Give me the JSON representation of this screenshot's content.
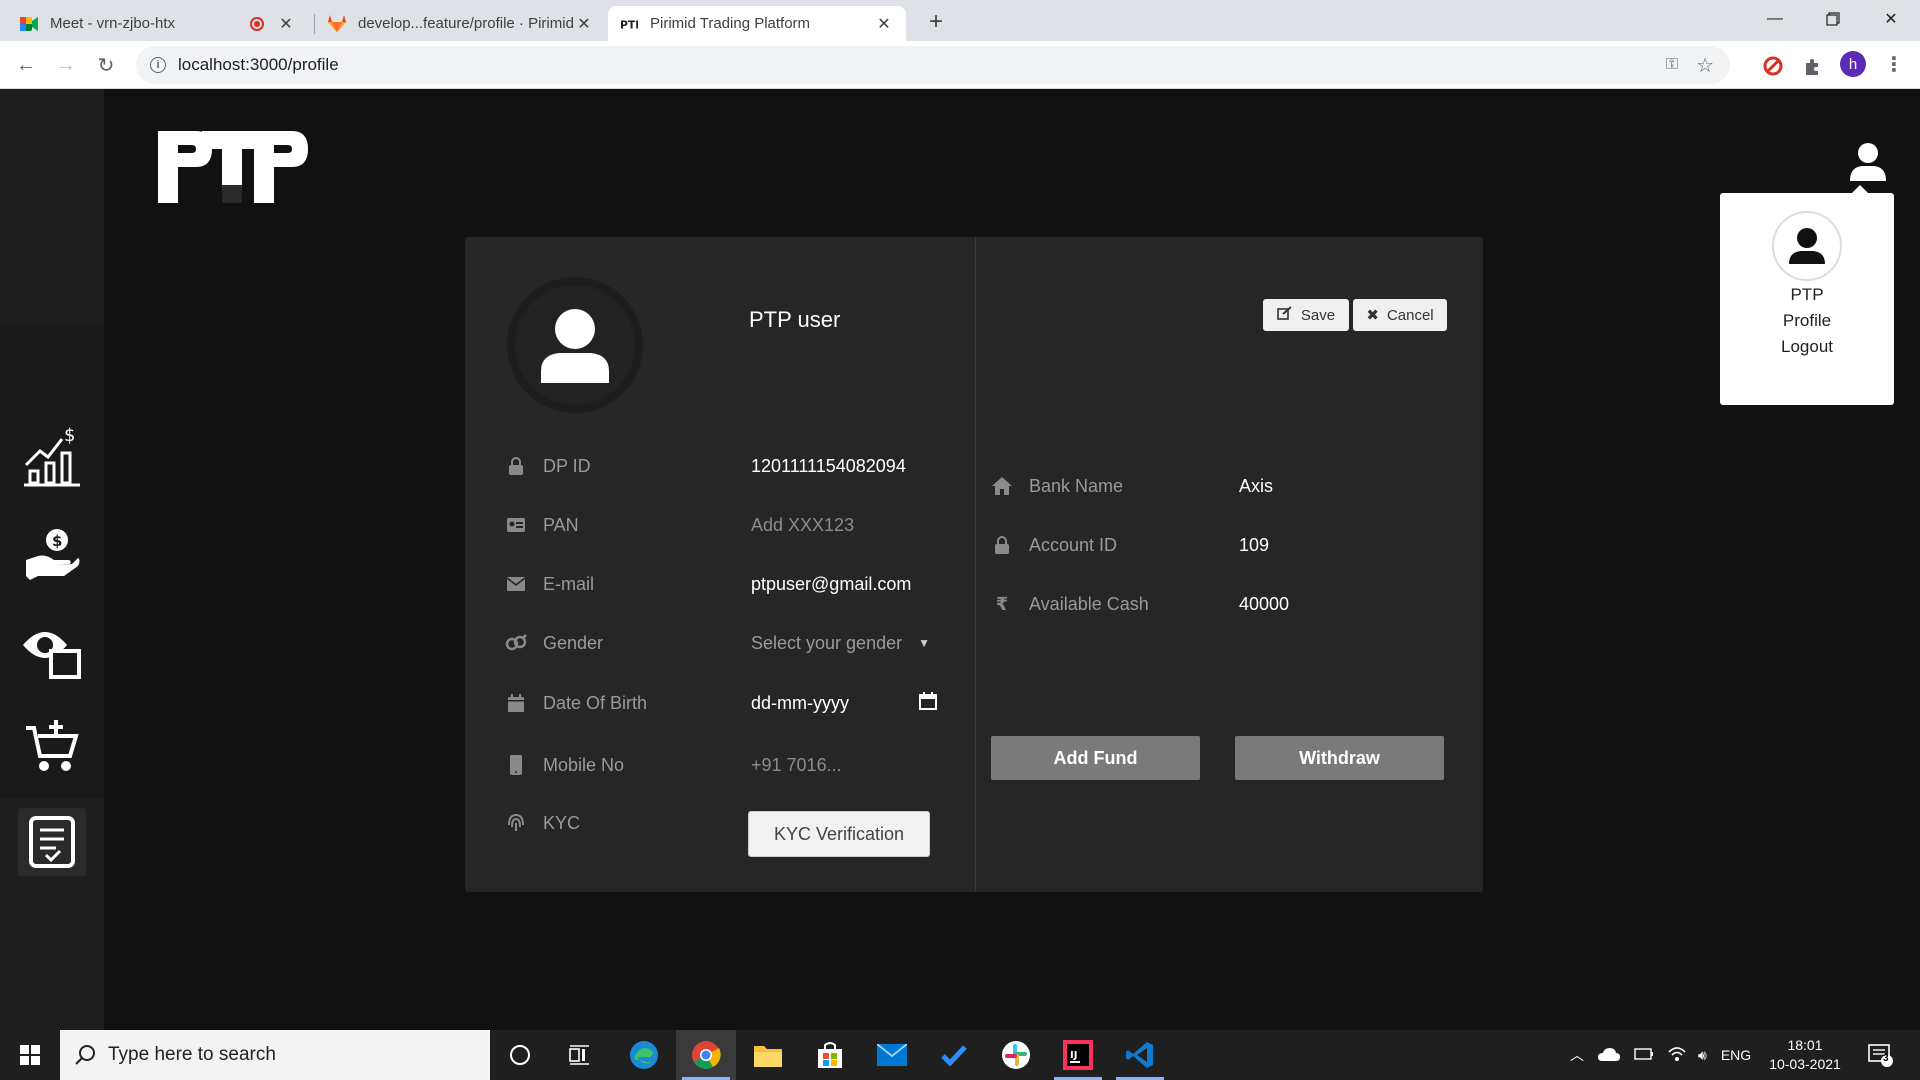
{
  "browser": {
    "tabs": [
      {
        "title": "Meet - vrn-zjbo-htx"
      },
      {
        "title": "develop...feature/profile · Pirimid"
      },
      {
        "title": "Pirimid Trading Platform"
      }
    ],
    "url": "localhost:3000/profile",
    "profile_initial": "h"
  },
  "app": {
    "logo_text": "PTP",
    "user_menu": {
      "name": "PTP",
      "items": [
        "Profile",
        "Logout"
      ]
    },
    "profile": {
      "username": "PTP user",
      "save_label": "Save",
      "cancel_label": "Cancel",
      "fields": [
        {
          "label": "DP ID",
          "value": "1201111154082094"
        },
        {
          "label": "PAN",
          "placeholder": "Add XXX123"
        },
        {
          "label": "E-mail",
          "value": "ptpuser@gmail.com"
        },
        {
          "label": "Gender",
          "value": "Select your gender"
        },
        {
          "label": "Date Of Birth",
          "value": "dd-mm-yyyy"
        },
        {
          "label": "Mobile No",
          "placeholder": "+91 7016..."
        },
        {
          "label": "KYC"
        }
      ],
      "kyc_button": "KYC Verification",
      "bank": [
        {
          "label": "Bank Name",
          "value": "Axis"
        },
        {
          "label": "Account ID",
          "value": "109"
        },
        {
          "label": "Available Cash",
          "value": "40000"
        }
      ],
      "add_fund_label": "Add Fund",
      "withdraw_label": "Withdraw"
    }
  },
  "taskbar": {
    "search_placeholder": "Type here to search",
    "language": "ENG",
    "time": "18:01",
    "date": "10-03-2021",
    "notification_count": "3"
  },
  "colors": {
    "app_bg": "#111111",
    "card_bg": "#262626",
    "sidebar_bg": "#1e1e1e",
    "fund_button": "#7a7a7a"
  }
}
